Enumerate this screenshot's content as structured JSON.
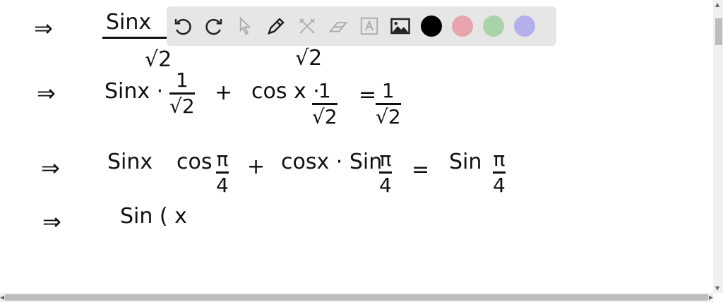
{
  "toolbar": {
    "tools": [
      "undo-icon",
      "redo-icon",
      "pointer-icon",
      "pen-icon",
      "tools-icon",
      "eraser-icon",
      "text-icon",
      "image-icon"
    ],
    "colors": [
      "#000000",
      "#e8a5ad",
      "#a9d4aa",
      "#b4b0ea"
    ]
  },
  "board": {
    "arrow": "⇒",
    "line1": {
      "num": "Sinx",
      "den": "√2",
      "den2": "√2"
    },
    "line2": {
      "a": "Sinx ·",
      "f1n": "1",
      "f1d": "√2",
      "plus": "+",
      "b": "cos x ·",
      "f2n": "1",
      "f2d": "√2",
      "eq": "=",
      "f3n": "1",
      "f3d": "√2"
    },
    "line3": {
      "a": "Sinx",
      "b": "cos",
      "f1n": "π",
      "f1d": "4",
      "plus": "+",
      "c": "cosx · Sin",
      "f2n": "π",
      "f2d": "4",
      "eq": "=",
      "d": "Sin",
      "f3n": "π",
      "f3d": "4"
    },
    "line4": {
      "a": "Sin ( x"
    }
  },
  "scroll": {
    "up": "▲",
    "down": "▼",
    "left": "◀",
    "right": "▶"
  }
}
